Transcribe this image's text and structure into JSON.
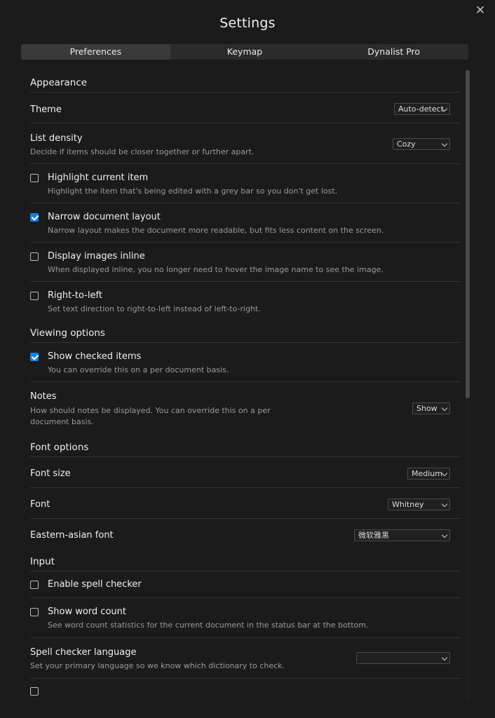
{
  "window": {
    "title": "Settings",
    "close_icon": "close-icon"
  },
  "tabs": [
    {
      "label": "Preferences",
      "active": true
    },
    {
      "label": "Keymap",
      "active": false
    },
    {
      "label": "Dynalist Pro",
      "active": false
    }
  ],
  "appearance": {
    "title": "Appearance",
    "theme": {
      "label": "Theme",
      "value": "Auto-detect"
    },
    "density": {
      "label": "List density",
      "desc": "Decide if items should be closer together or further apart.",
      "value": "Cozy"
    },
    "highlight": {
      "label": "Highlight current item",
      "desc": "Highlight the item that's being edited with a grey bar so you don't get lost.",
      "checked": false
    },
    "narrow": {
      "label": "Narrow document layout",
      "desc": "Narrow layout makes the document more readable, but fits less content on the screen.",
      "checked": true
    },
    "images": {
      "label": "Display images inline",
      "desc": "When displayed inline, you no longer need to hover the image name to see the image.",
      "checked": false
    },
    "rtl": {
      "label": "Right-to-left",
      "desc": "Set text direction to right-to-left instead of left-to-right.",
      "checked": false
    }
  },
  "viewing": {
    "title": "Viewing options",
    "checked_items": {
      "label": "Show checked items",
      "desc": "You can override this on a per document basis.",
      "checked": true
    },
    "notes": {
      "label": "Notes",
      "desc1": "How should notes be displayed. You can override this on a per",
      "desc2": "document basis.",
      "value": "Show"
    }
  },
  "font": {
    "title": "Font options",
    "size": {
      "label": "Font size",
      "value": "Medium"
    },
    "font": {
      "label": "Font",
      "value": "Whitney"
    },
    "eastern": {
      "label": "Eastern-asian font",
      "value": "微软雅黑"
    }
  },
  "input": {
    "title": "Input",
    "spell": {
      "label": "Enable spell checker",
      "checked": false
    },
    "wordcount": {
      "label": "Show word count",
      "desc": "See word count statistics for the current document in the status bar at the bottom.",
      "checked": false
    },
    "spell_lang": {
      "label": "Spell checker language",
      "desc": "Set your primary language so we know which dictionary to check.",
      "value": ""
    }
  },
  "colors": {
    "accent": "#1a7fe0",
    "background": "#1b1b1b"
  }
}
